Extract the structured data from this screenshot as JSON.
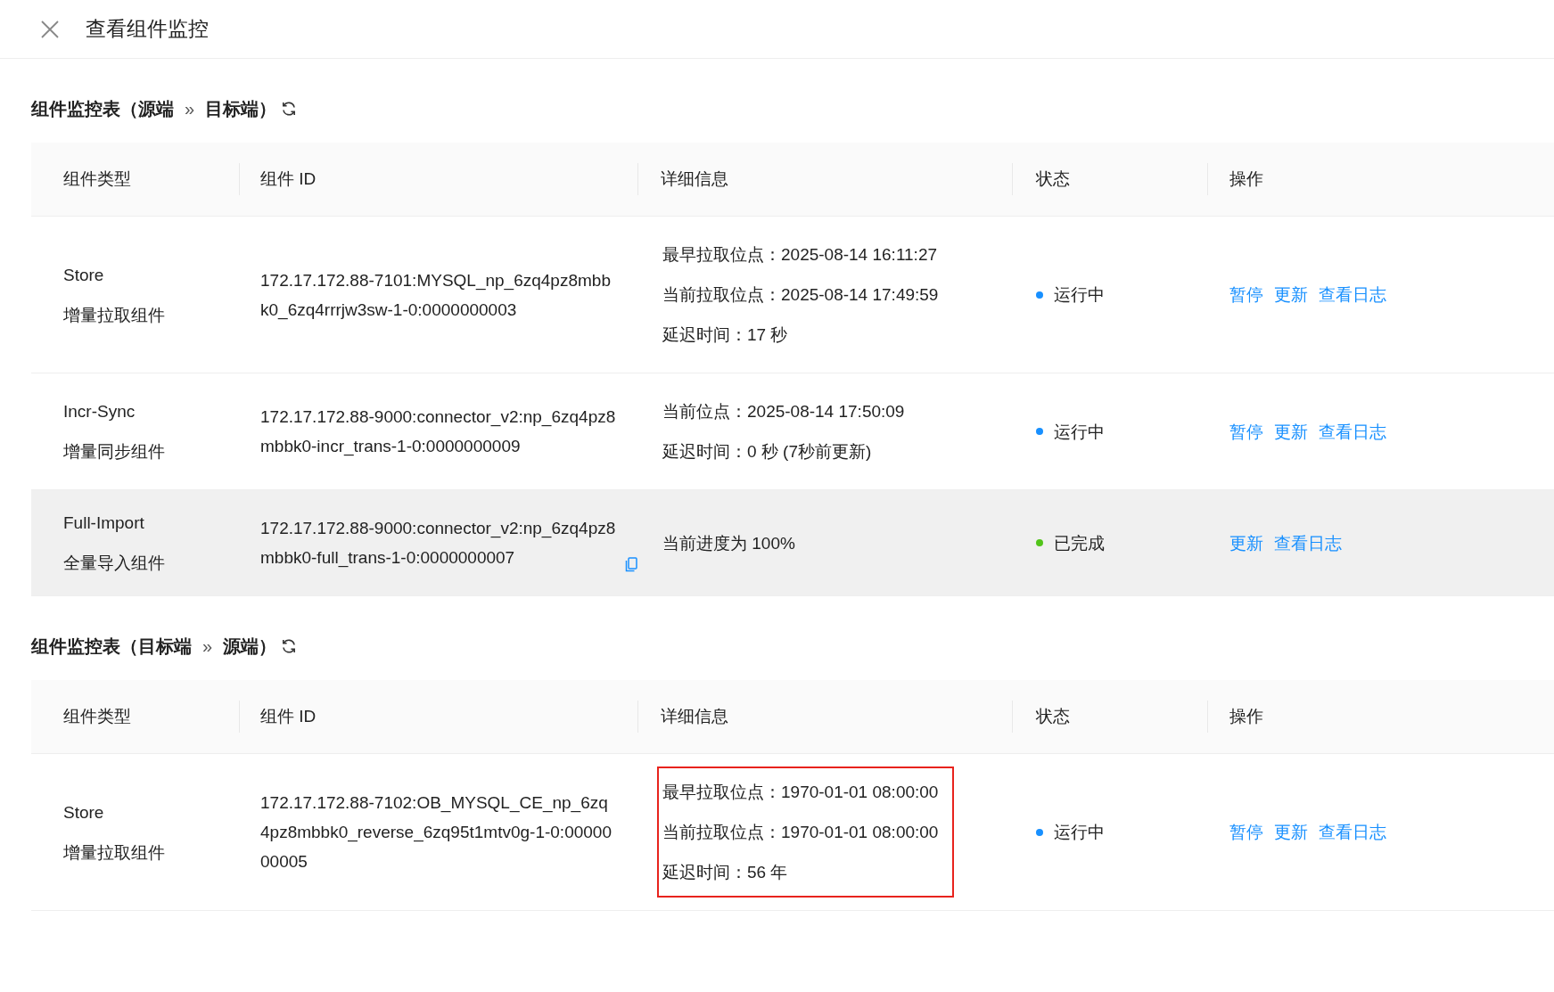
{
  "header": {
    "title": "查看组件监控"
  },
  "sections": [
    {
      "title_parts": [
        "组件监控表（源端",
        "目标端）"
      ],
      "separator": "»",
      "columns": [
        "组件类型",
        "组件 ID",
        "详细信息",
        "状态",
        "操作"
      ],
      "rows": [
        {
          "type": "Store",
          "type_desc": "增量拉取组件",
          "id": "172.17.172.88-7101:MYSQL_np_6zq4pz8mbbk0_6zq4rrrjw3sw-1-0:0000000003",
          "copyable": false,
          "details": [
            "最早拉取位点：2025-08-14 16:11:27",
            "当前拉取位点：2025-08-14 17:49:59",
            "延迟时间：17 秒"
          ],
          "outlined": false,
          "status": "运行中",
          "color": "#1890ff",
          "actions": [
            "暂停",
            "更新",
            "查看日志"
          ],
          "highlighted": false
        },
        {
          "type": "Incr-Sync",
          "type_desc": "增量同步组件",
          "id": "172.17.172.88-9000:connector_v2:np_6zq4pz8mbbk0-incr_trans-1-0:0000000009",
          "copyable": false,
          "details": [
            "当前位点：2025-08-14 17:50:09",
            "延迟时间：0 秒 (7秒前更新)"
          ],
          "outlined": false,
          "status": "运行中",
          "color": "#1890ff",
          "actions": [
            "暂停",
            "更新",
            "查看日志"
          ],
          "highlighted": false
        },
        {
          "type": "Full-Import",
          "type_desc": "全量导入组件",
          "id": "172.17.172.88-9000:connector_v2:np_6zq4pz8mbbk0-full_trans-1-0:0000000007",
          "copyable": true,
          "details": [
            "当前进度为 100%"
          ],
          "outlined": false,
          "status": "已完成",
          "color": "#52c41a",
          "actions": [
            "更新",
            "查看日志"
          ],
          "highlighted": true
        }
      ]
    },
    {
      "title_parts": [
        "组件监控表（目标端",
        "源端）"
      ],
      "separator": "»",
      "columns": [
        "组件类型",
        "组件 ID",
        "详细信息",
        "状态",
        "操作"
      ],
      "rows": [
        {
          "type": "Store",
          "type_desc": "增量拉取组件",
          "id": "172.17.172.88-7102:OB_MYSQL_CE_np_6zq4pz8mbbk0_reverse_6zq95t1mtv0g-1-0:0000000005",
          "copyable": false,
          "details": [
            "最早拉取位点：1970-01-01 08:00:00",
            "当前拉取位点：1970-01-01 08:00:00",
            "延迟时间：56 年"
          ],
          "outlined": true,
          "status": "运行中",
          "color": "#1890ff",
          "actions": [
            "暂停",
            "更新",
            "查看日志"
          ],
          "highlighted": false
        }
      ]
    }
  ]
}
